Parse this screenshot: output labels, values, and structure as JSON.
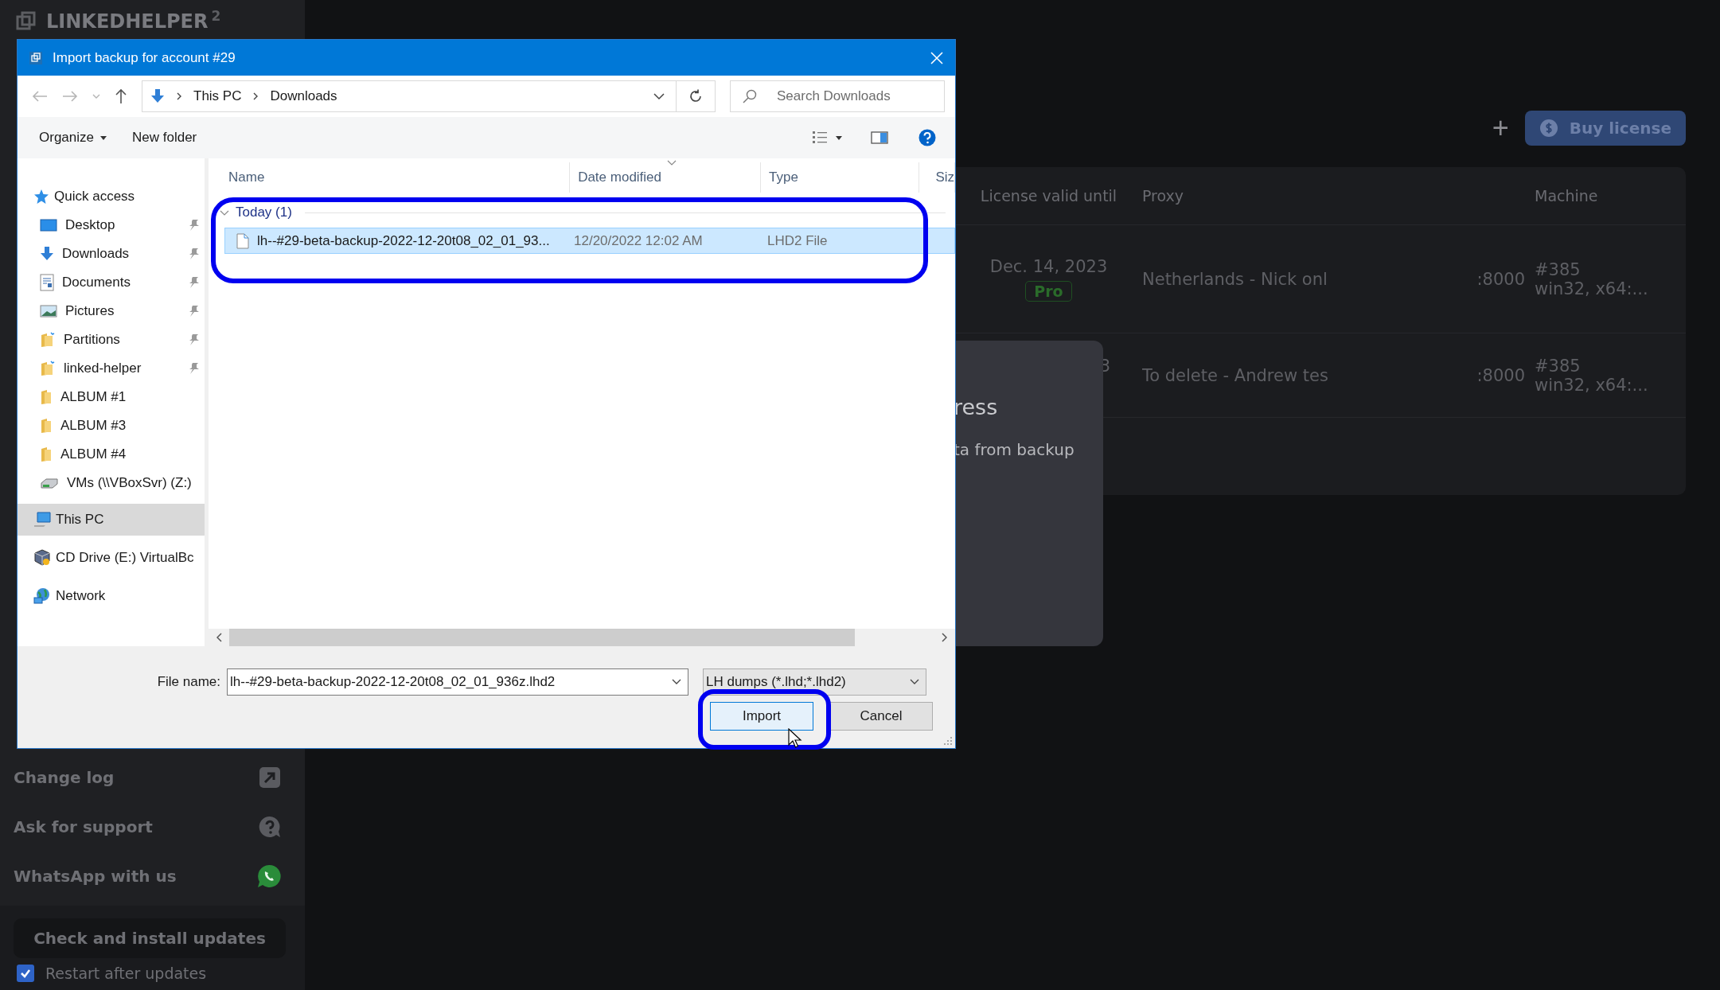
{
  "app": {
    "logo": "LINKEDHELPER",
    "logo_sup": "2",
    "sidebar_links": [
      {
        "label": "Change log",
        "kind": "external"
      },
      {
        "label": "Ask for support",
        "kind": "support"
      },
      {
        "label": "WhatsApp with us",
        "kind": "whatsapp"
      }
    ],
    "update_button": "Check and install updates",
    "restart_checkbox": {
      "label": "Restart after updates",
      "checked": true
    },
    "add_button": "+",
    "buy_button": "Buy license",
    "table": {
      "columns": [
        "License valid until",
        "Proxy",
        "Machine"
      ],
      "rows": [
        {
          "license_date": "Dec. 14, 2023",
          "badge": "Pro",
          "proxy": "Netherlands - Nick onl",
          "port": ":8000",
          "machine": "#385",
          "machine_detail": "win32, x64:..."
        },
        {
          "license_date": "3",
          "proxy": "To delete - Andrew tes",
          "port": ":8000",
          "machine": "#385",
          "machine_detail": "win32, x64:..."
        }
      ]
    },
    "progress_modal": {
      "title": "ress",
      "text": "ta from backup"
    }
  },
  "dialog": {
    "title": "Import backup for account #29",
    "breadcrumb": [
      "This PC",
      "Downloads"
    ],
    "search": {
      "placeholder": "Search Downloads"
    },
    "toolbar": [
      {
        "label": "Organize",
        "kind": "menu"
      },
      {
        "label": "New folder",
        "kind": "button"
      }
    ],
    "nav": [
      {
        "label": "Quick access",
        "kind": "star",
        "selected": false,
        "children": [
          {
            "label": "Desktop",
            "kind": "desktop",
            "pinned": true,
            "selected": false
          },
          {
            "label": "Downloads",
            "kind": "download",
            "pinned": true,
            "selected": false
          },
          {
            "label": "Documents",
            "kind": "documents",
            "pinned": true,
            "selected": false
          },
          {
            "label": "Pictures",
            "kind": "pictures",
            "pinned": true,
            "selected": false
          },
          {
            "label": "Partitions",
            "kind": "special-folder",
            "pinned": true,
            "selected": false
          },
          {
            "label": "linked-helper",
            "kind": "special-folder",
            "pinned": true,
            "selected": false
          },
          {
            "label": "ALBUM #1",
            "kind": "folder",
            "pinned": false,
            "selected": false
          },
          {
            "label": "ALBUM #3",
            "kind": "folder",
            "pinned": false,
            "selected": false
          },
          {
            "label": "ALBUM #4",
            "kind": "folder",
            "pinned": false,
            "selected": false
          },
          {
            "label": "VMs (\\\\VBoxSvr) (Z:)",
            "kind": "drive",
            "pinned": false,
            "selected": false
          }
        ]
      },
      {
        "label": "This PC",
        "kind": "pc",
        "selected": true
      },
      {
        "label": "CD Drive (E:) VirtualBc",
        "kind": "cd",
        "selected": false
      },
      {
        "label": "Network",
        "kind": "network",
        "selected": false
      }
    ],
    "columns": [
      "Name",
      "Date modified",
      "Type",
      "Siz"
    ],
    "groups": [
      {
        "label": "Today (1)",
        "expanded": true,
        "files": [
          {
            "name": "lh--#29-beta-backup-2022-12-20t08_02_01_93...",
            "date": "12/20/2022 12:02 AM",
            "type": "LHD2 File",
            "selected": true
          }
        ]
      }
    ],
    "file_name": {
      "label": "File name:",
      "value": "lh--#29-beta-backup-2022-12-20t08_02_01_936z.lhd2"
    },
    "file_type": "LH dumps (*.lhd;*.lhd2)",
    "buttons": [
      {
        "label": "Import",
        "kind": "primary"
      },
      {
        "label": "Cancel",
        "kind": "secondary"
      }
    ]
  }
}
